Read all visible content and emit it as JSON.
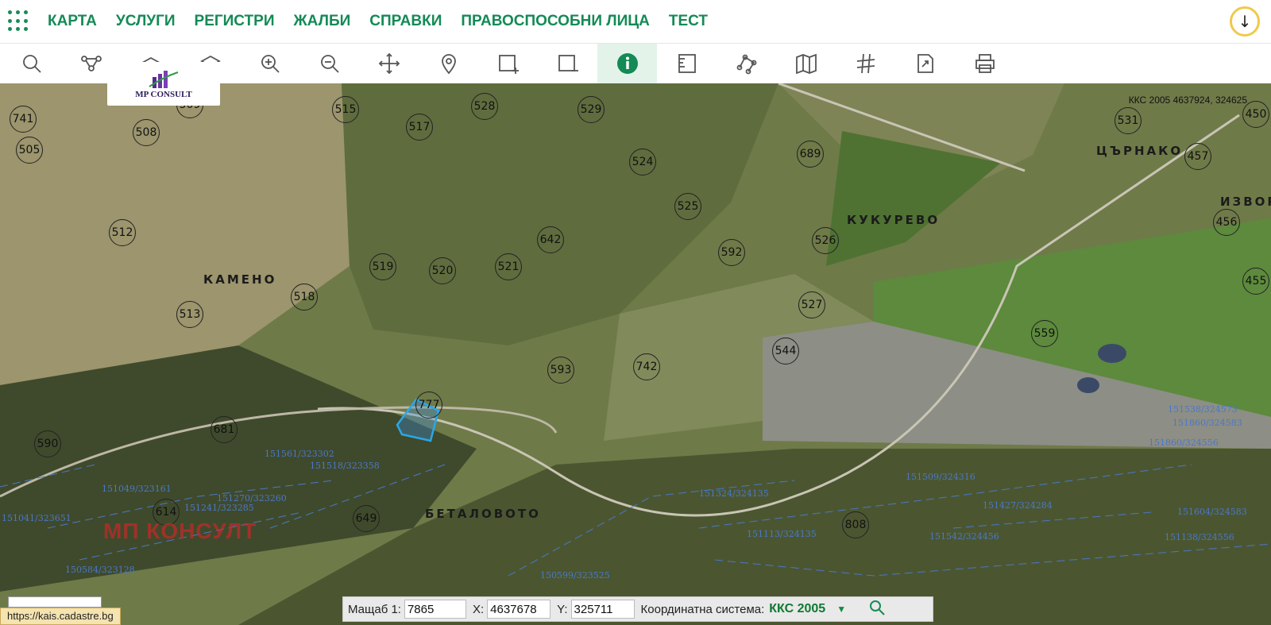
{
  "nav": {
    "items": [
      "КАРТА",
      "УСЛУГИ",
      "РЕГИСТРИ",
      "ЖАЛБИ",
      "СПРАВКИ",
      "ПРАВОСПОСОБНИ ЛИЦА",
      "ТЕСТ"
    ]
  },
  "toolbar": {
    "tools": [
      "search-icon",
      "route-icon",
      "layer-up-icon",
      "layer-down-icon",
      "zoom-in-icon",
      "zoom-out-icon",
      "pan-icon",
      "marker-icon",
      "select-add-icon",
      "select-remove-icon",
      "info-icon",
      "measure-icon",
      "polyline-icon",
      "map-icon",
      "grid-icon",
      "export-icon",
      "print-icon"
    ],
    "active": "info-icon"
  },
  "logo": {
    "text": "MP CONSULT"
  },
  "map": {
    "coords_readout": "ККС 2005 4637924, 324625",
    "watermark": "МП КОНСУЛТ",
    "places": [
      {
        "name": "КАМЕНО"
      },
      {
        "name": "КУКУРЕВО"
      },
      {
        "name": "ЦЪРНАКО"
      },
      {
        "name": "ИЗВОР"
      },
      {
        "name": "БЕТАЛОВОТО"
      }
    ],
    "parcels": [
      "741",
      "505",
      "508",
      "509",
      "515",
      "528",
      "529",
      "517",
      "524",
      "689",
      "531",
      "450",
      "457",
      "456",
      "512",
      "642",
      "525",
      "592",
      "526",
      "519",
      "520",
      "521",
      "518",
      "527",
      "455",
      "513",
      "559",
      "544",
      "593",
      "742",
      "777",
      "681",
      "590",
      "614",
      "649",
      "808"
    ],
    "cadastre_labels": [
      "151561/323302",
      "151518/323358",
      "151049/323161",
      "151041/323651",
      "151241/323285",
      "151270/323260",
      "150584/323128",
      "151113/324135",
      "151427/324284",
      "151538/324573",
      "151860/324583",
      "151604/324583",
      "151860/324556",
      "151138/324556",
      "150599/323525",
      "151324/324135",
      "151509/324316",
      "151542/324456"
    ]
  },
  "statusbar": {
    "scale_label": "Мащаб 1:",
    "scale_value": "7865",
    "x_label": "X:",
    "x_value": "4637678",
    "y_label": "Y:",
    "y_value": "325711",
    "crs_label": "Координатна система:",
    "crs_value": "ККС 2005"
  },
  "url_tip": "https://kais.cadastre.bg",
  "colors": {
    "accent": "#148a55",
    "parcel_highlight": "#2aa7e8",
    "download_ring": "#f0c94a"
  }
}
